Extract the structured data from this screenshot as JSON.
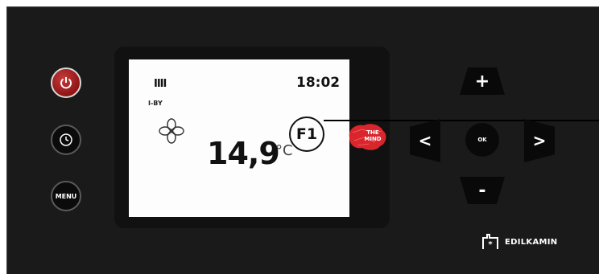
{
  "display": {
    "flame_indicator": "IIII",
    "time": "18:02",
    "mode": "I-BY",
    "temperature": "14,9",
    "unit": "°C",
    "fan_icon": "fan-icon",
    "flame_icon": "flame-level-icon"
  },
  "callout": {
    "label": "F1"
  },
  "side_buttons": {
    "power_icon": "power-icon",
    "clock_icon": "clock-icon",
    "menu_label": "MENU"
  },
  "nav_buttons": {
    "plus_label": "+",
    "minus_label": "-",
    "left_label": "<",
    "right_label": ">",
    "ok_label": "OK"
  },
  "badge": {
    "line1": "THE",
    "line2": "MIND",
    "icon": "brain-icon"
  },
  "brand": {
    "name": "EDILKAMIN",
    "icon": "edilkamin-logo-icon"
  },
  "colors": {
    "panel": "#1a1a1a",
    "power_button": "#b02a2a",
    "badge": "#d9252c",
    "lcd_background": "#fdfdfd"
  }
}
